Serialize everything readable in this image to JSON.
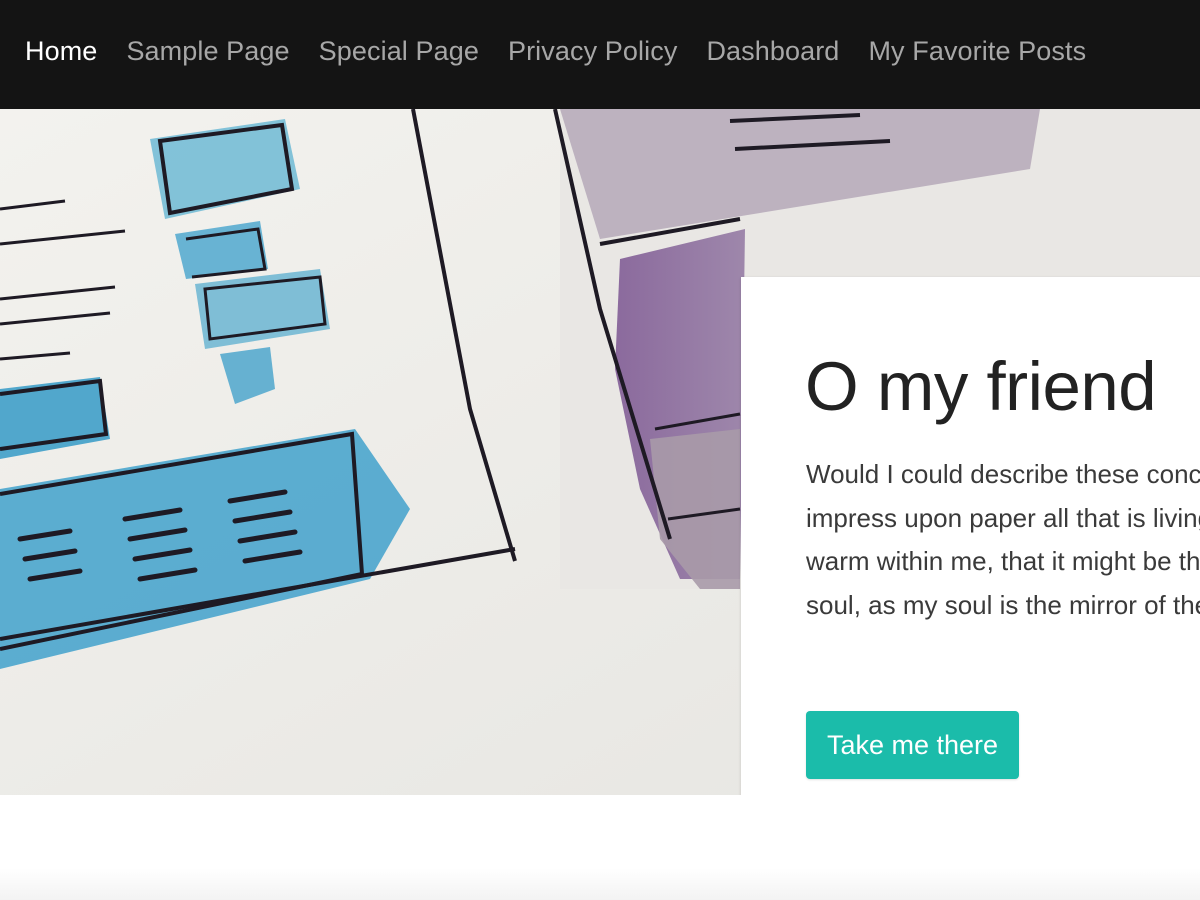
{
  "nav": {
    "items": [
      {
        "label": "Home",
        "active": true
      },
      {
        "label": "Sample Page",
        "active": false
      },
      {
        "label": "Special Page",
        "active": false
      },
      {
        "label": "Privacy Policy",
        "active": false
      },
      {
        "label": "Dashboard",
        "active": false
      },
      {
        "label": "My Favorite Posts",
        "active": false
      }
    ]
  },
  "hero": {
    "image": "watercolor-wireframe-sketch",
    "card": {
      "title": "O my friend",
      "body": "Would I could describe these conceptions, could impress upon paper all that is living so full and warm within me, that it might be the mirror of my soul, as my soul is the mirror of the infinite.",
      "cta_label": "Take me there"
    }
  },
  "colors": {
    "nav_bg": "#141414",
    "nav_text": "#a7a7a7",
    "nav_active": "#ffffff",
    "accent": "#1bbcaa",
    "card_bg": "#ffffff"
  }
}
